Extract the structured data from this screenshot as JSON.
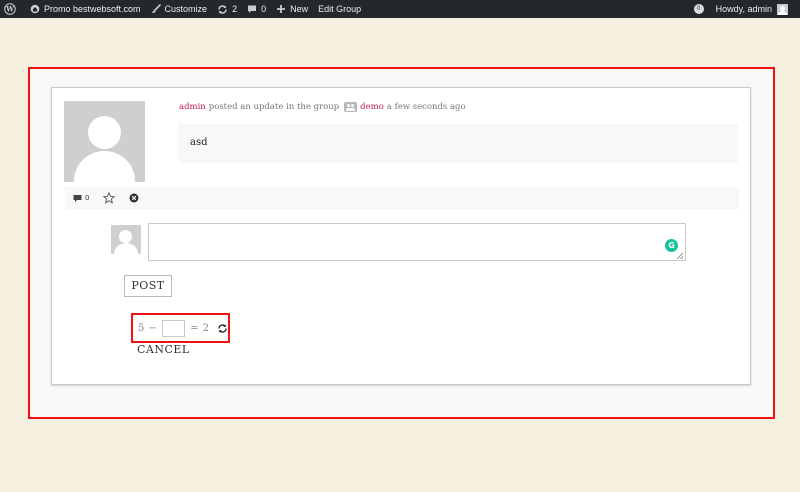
{
  "adminbar": {
    "site_name": "Promo bestwebsoft.com",
    "customize": "Customize",
    "updates_count": "2",
    "comments_count": "0",
    "new": "New",
    "edit_group": "Edit Group",
    "notifications_count": "0",
    "howdy": "Howdy, admin"
  },
  "activity": {
    "user": "admin",
    "action_text": "posted an update in the group",
    "group": "demo",
    "time": "a few seconds ago",
    "content": "asd",
    "comment_count": "0"
  },
  "comment_form": {
    "input_value": "",
    "post_label": "POST",
    "cancel_label": "CANCEL"
  },
  "captcha": {
    "left": "5",
    "operator": "−",
    "equals": "=",
    "result": "2",
    "input_value": ""
  },
  "colors": {
    "highlight": "#ee1111",
    "link": "#c01b4c",
    "adminbar": "#23282d",
    "background": "#f5efe0",
    "grammarly": "#15c39a"
  }
}
